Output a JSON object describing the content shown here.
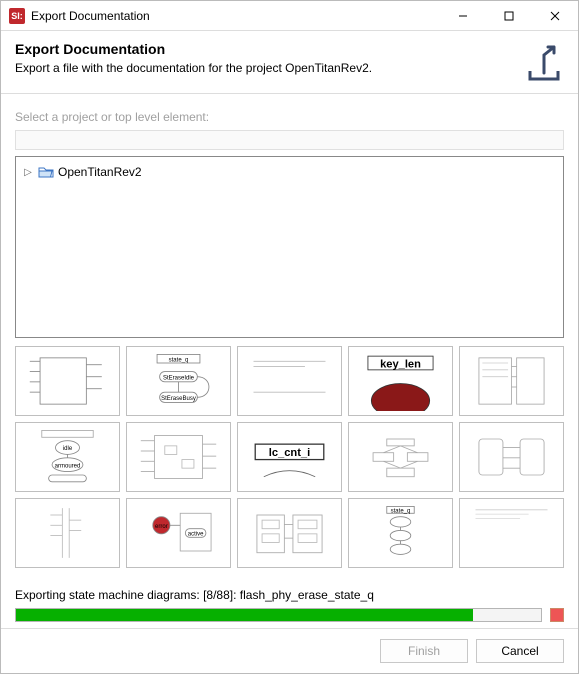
{
  "window": {
    "app_badge": "SI:",
    "title": "Export Documentation"
  },
  "header": {
    "title": "Export Documentation",
    "subtitle": "Export a file with the documentation for the project OpenTitanRev2."
  },
  "picker": {
    "label": "Select a project or top level element:",
    "filter_value": "",
    "root_node": "OpenTitanRev2"
  },
  "thumbnails": [
    {
      "id": "diag-01",
      "caption": ""
    },
    {
      "id": "diag-02",
      "caption": "state_q",
      "sub1": "StEraseIdle",
      "sub2": "StEraseBusy"
    },
    {
      "id": "diag-03",
      "caption": ""
    },
    {
      "id": "diag-04",
      "caption": "key_len"
    },
    {
      "id": "diag-05",
      "caption": ""
    },
    {
      "id": "diag-06",
      "caption": "",
      "sub1": "idle",
      "sub2": "armoured"
    },
    {
      "id": "diag-07",
      "caption": ""
    },
    {
      "id": "diag-08",
      "caption": "lc_cnt_i"
    },
    {
      "id": "diag-09",
      "caption": ""
    },
    {
      "id": "diag-10",
      "caption": ""
    },
    {
      "id": "diag-11",
      "caption": ""
    },
    {
      "id": "diag-12",
      "caption": "",
      "sub1": "error",
      "sub2": "active"
    },
    {
      "id": "diag-13",
      "caption": ""
    },
    {
      "id": "diag-14",
      "caption": "state_q"
    },
    {
      "id": "diag-15",
      "caption": ""
    }
  ],
  "progress": {
    "label": "Exporting state machine diagrams: [8/88]: flash_phy_erase_state_q",
    "percent": 87
  },
  "buttons": {
    "finish": "Finish",
    "cancel": "Cancel"
  }
}
